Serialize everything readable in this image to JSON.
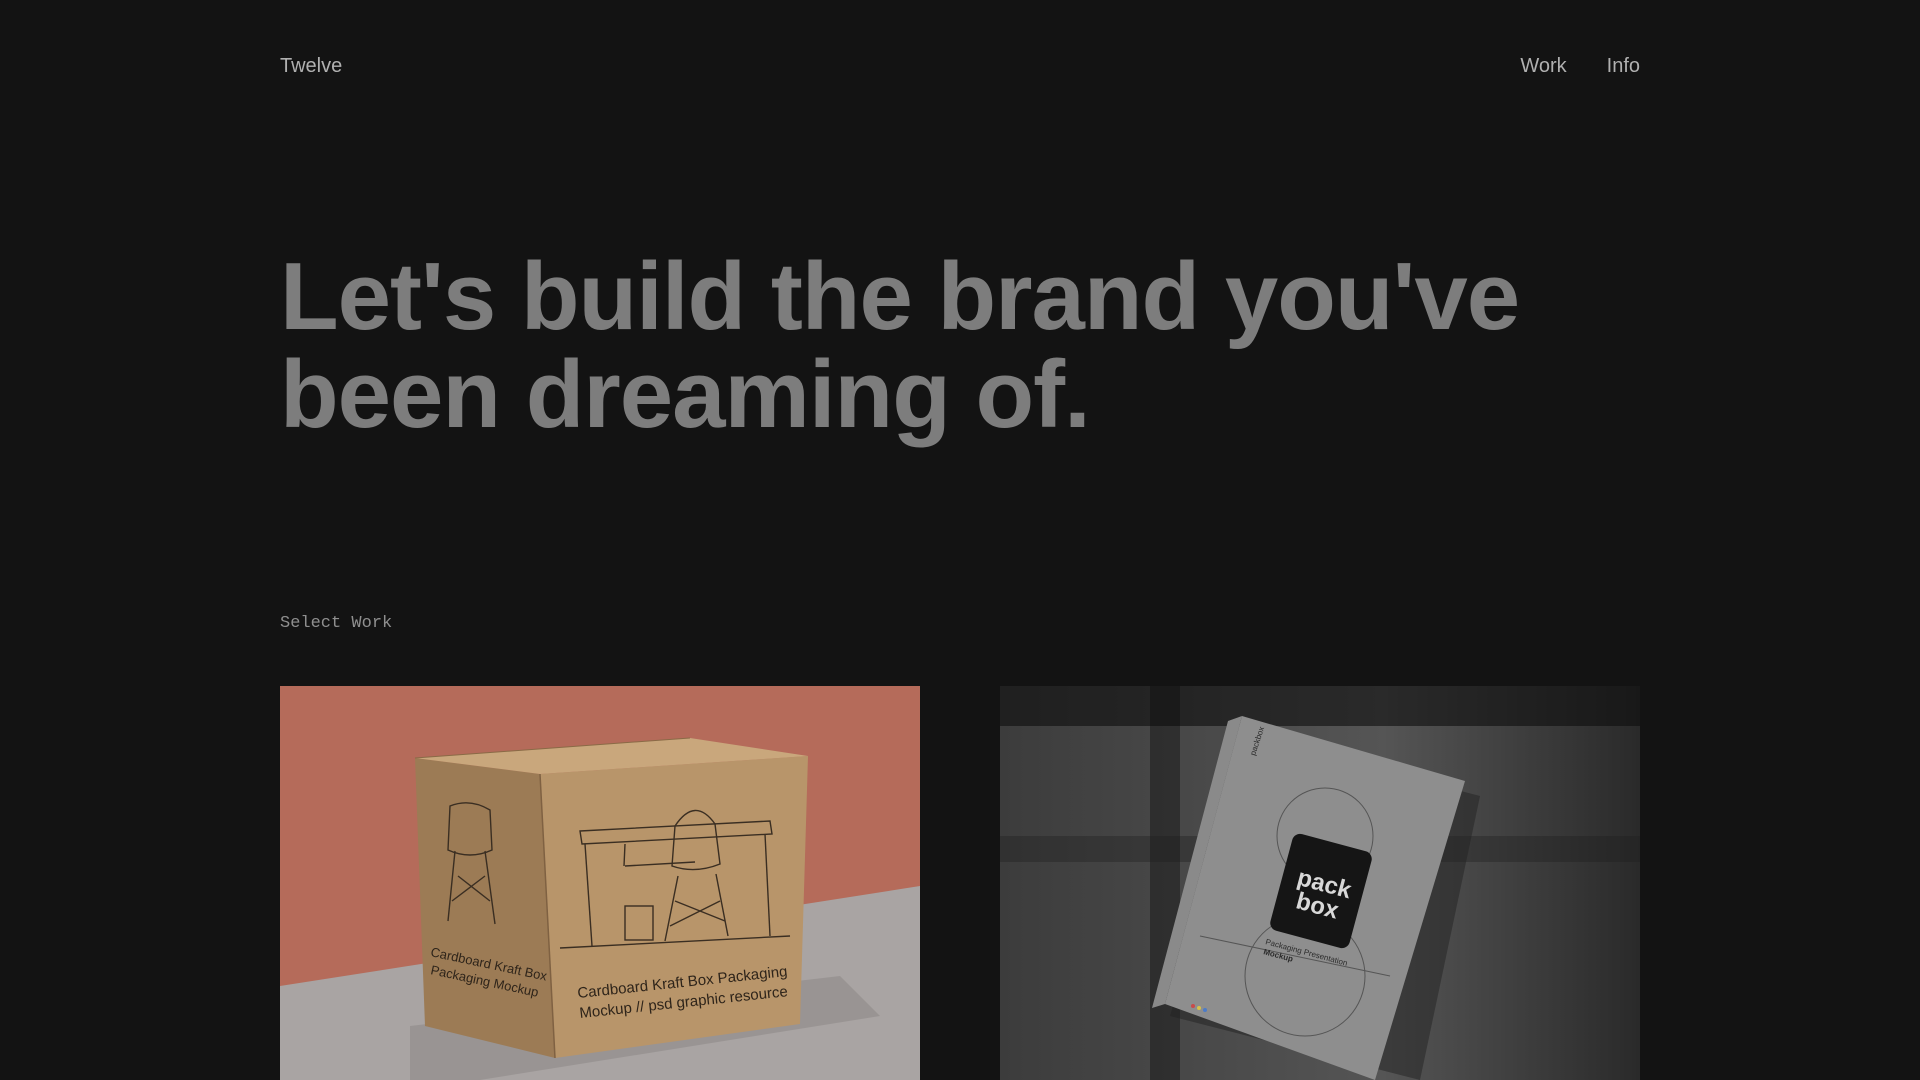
{
  "header": {
    "logo": "Twelve",
    "nav": [
      "Work",
      "Info"
    ]
  },
  "hero": {
    "headline": "Let's build the brand you've been dreaming of."
  },
  "work": {
    "section_label": "Select Work",
    "projects": [
      {
        "image": "cardboard-kraft-box-mockup",
        "box_text_1": "Cardboard Kraft Box Packaging",
        "box_text_2": "Mockup // psd graphic resource",
        "side_text_1": "Cardboard Kraft Box",
        "side_text_2": "Packaging Mockup"
      },
      {
        "image": "pack-box-presentation-mockup",
        "label_1": "pack",
        "label_2": "box",
        "sub_1": "Packaging Presentation",
        "sub_2": "Mockup",
        "spine": "packbox"
      }
    ]
  },
  "colors": {
    "background": "#131313",
    "headline": "#7d7d7d",
    "nav_text": "#b0b0b0",
    "kraft": "#b8956a",
    "wall": "#b56b5a"
  }
}
